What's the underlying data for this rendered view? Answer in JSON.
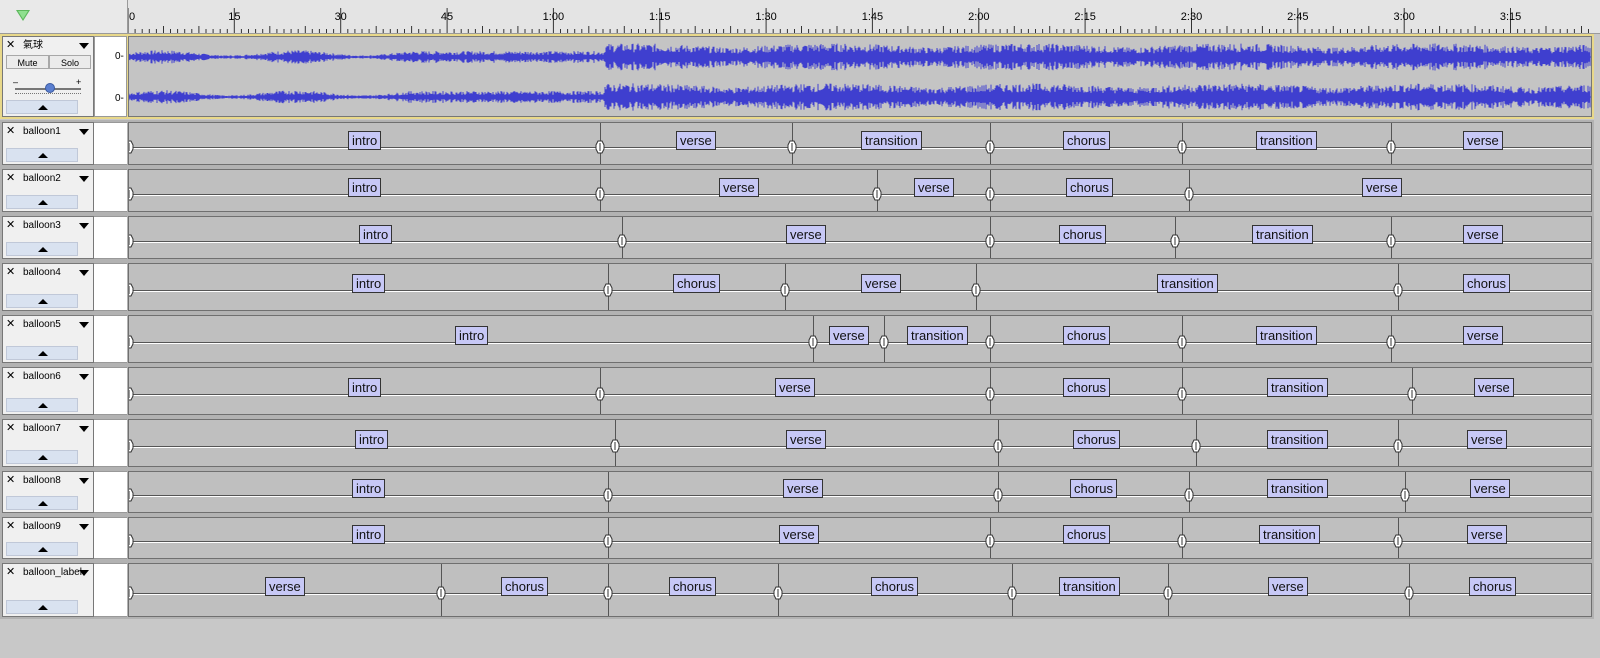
{
  "ruler": {
    "ticks": [
      "0",
      "15",
      "30",
      "45",
      "1:00",
      "1:15",
      "1:30",
      "1:45",
      "2:00",
      "2:15",
      "2:30",
      "2:45",
      "3:00",
      "3:15"
    ]
  },
  "audio_track": {
    "name": "氣球",
    "mute_label": "Mute",
    "solo_label": "Solo",
    "gain_minus": "–",
    "gain_plus": "+",
    "channel_zero": [
      "0-",
      "0-"
    ],
    "wave_color": "#3f3fcf"
  },
  "label_tracks": [
    {
      "name": "balloon1",
      "labels": [
        {
          "text": "intro",
          "start": 0,
          "end": 66.5
        },
        {
          "text": "verse",
          "start": 66.5,
          "end": 93.5
        },
        {
          "text": "transition",
          "start": 93.5,
          "end": 121.5
        },
        {
          "text": "chorus",
          "start": 121.5,
          "end": 148.5
        },
        {
          "text": "transition",
          "start": 148.5,
          "end": 178
        },
        {
          "text": "verse",
          "start": 178,
          "end": 204
        }
      ]
    },
    {
      "name": "balloon2",
      "labels": [
        {
          "text": "intro",
          "start": 0,
          "end": 66.5
        },
        {
          "text": "verse",
          "start": 66.5,
          "end": 105.5
        },
        {
          "text": "verse",
          "start": 105.5,
          "end": 121.5
        },
        {
          "text": "chorus",
          "start": 121.5,
          "end": 149.5
        },
        {
          "text": "verse",
          "start": 149.5,
          "end": 204
        }
      ]
    },
    {
      "name": "balloon3",
      "labels": [
        {
          "text": "intro",
          "start": 0,
          "end": 69.5
        },
        {
          "text": "verse",
          "start": 69.5,
          "end": 121.5
        },
        {
          "text": "chorus",
          "start": 121.5,
          "end": 147.5
        },
        {
          "text": "transition",
          "start": 147.5,
          "end": 178
        },
        {
          "text": "verse",
          "start": 178,
          "end": 204
        }
      ]
    },
    {
      "name": "balloon4",
      "labels": [
        {
          "text": "intro",
          "start": 0,
          "end": 67.5
        },
        {
          "text": "chorus",
          "start": 67.5,
          "end": 92.5
        },
        {
          "text": "verse",
          "start": 92.5,
          "end": 119.5
        },
        {
          "text": "transition",
          "start": 119.5,
          "end": 179
        },
        {
          "text": "chorus",
          "start": 179,
          "end": 204
        }
      ]
    },
    {
      "name": "balloon5",
      "labels": [
        {
          "text": "intro",
          "start": 0,
          "end": 96.5
        },
        {
          "text": "verse",
          "start": 96.5,
          "end": 106.5
        },
        {
          "text": "transition",
          "start": 106.5,
          "end": 121.5
        },
        {
          "text": "chorus",
          "start": 121.5,
          "end": 148.5
        },
        {
          "text": "transition",
          "start": 148.5,
          "end": 178
        },
        {
          "text": "verse",
          "start": 178,
          "end": 204
        }
      ]
    },
    {
      "name": "balloon6",
      "labels": [
        {
          "text": "intro",
          "start": 0,
          "end": 66.5
        },
        {
          "text": "verse",
          "start": 66.5,
          "end": 121.5
        },
        {
          "text": "chorus",
          "start": 121.5,
          "end": 148.5
        },
        {
          "text": "transition",
          "start": 148.5,
          "end": 181
        },
        {
          "text": "verse",
          "start": 181,
          "end": 204
        }
      ]
    },
    {
      "name": "balloon7",
      "labels": [
        {
          "text": "intro",
          "start": 0,
          "end": 68.5
        },
        {
          "text": "verse",
          "start": 68.5,
          "end": 122.5
        },
        {
          "text": "chorus",
          "start": 122.5,
          "end": 150.5
        },
        {
          "text": "transition",
          "start": 150.5,
          "end": 179
        },
        {
          "text": "verse",
          "start": 179,
          "end": 204
        }
      ]
    },
    {
      "name": "balloon8",
      "labels": [
        {
          "text": "intro",
          "start": 0,
          "end": 67.5
        },
        {
          "text": "verse",
          "start": 67.5,
          "end": 122.5
        },
        {
          "text": "chorus",
          "start": 122.5,
          "end": 149.5
        },
        {
          "text": "transition",
          "start": 149.5,
          "end": 180
        },
        {
          "text": "verse",
          "start": 180,
          "end": 204
        }
      ]
    },
    {
      "name": "balloon9",
      "labels": [
        {
          "text": "intro",
          "start": 0,
          "end": 67.5
        },
        {
          "text": "verse",
          "start": 67.5,
          "end": 121.5
        },
        {
          "text": "chorus",
          "start": 121.5,
          "end": 148.5
        },
        {
          "text": "transition",
          "start": 148.5,
          "end": 179
        },
        {
          "text": "verse",
          "start": 179,
          "end": 204
        }
      ]
    },
    {
      "name": "balloon_label",
      "labels": [
        {
          "text": "verse",
          "start": 0,
          "end": 44
        },
        {
          "text": "chorus",
          "start": 44,
          "end": 67.5
        },
        {
          "text": "chorus",
          "start": 67.5,
          "end": 91.5
        },
        {
          "text": "chorus",
          "start": 91.5,
          "end": 124.5
        },
        {
          "text": "transition",
          "start": 124.5,
          "end": 146.5
        },
        {
          "text": "verse",
          "start": 146.5,
          "end": 180.5
        },
        {
          "text": "chorus",
          "start": 180.5,
          "end": 204
        }
      ]
    }
  ],
  "colors": {
    "label_fill": "#c7c8f6",
    "audio_selected_border": "#e8d88a",
    "lane_background": "#bfbfbf"
  }
}
